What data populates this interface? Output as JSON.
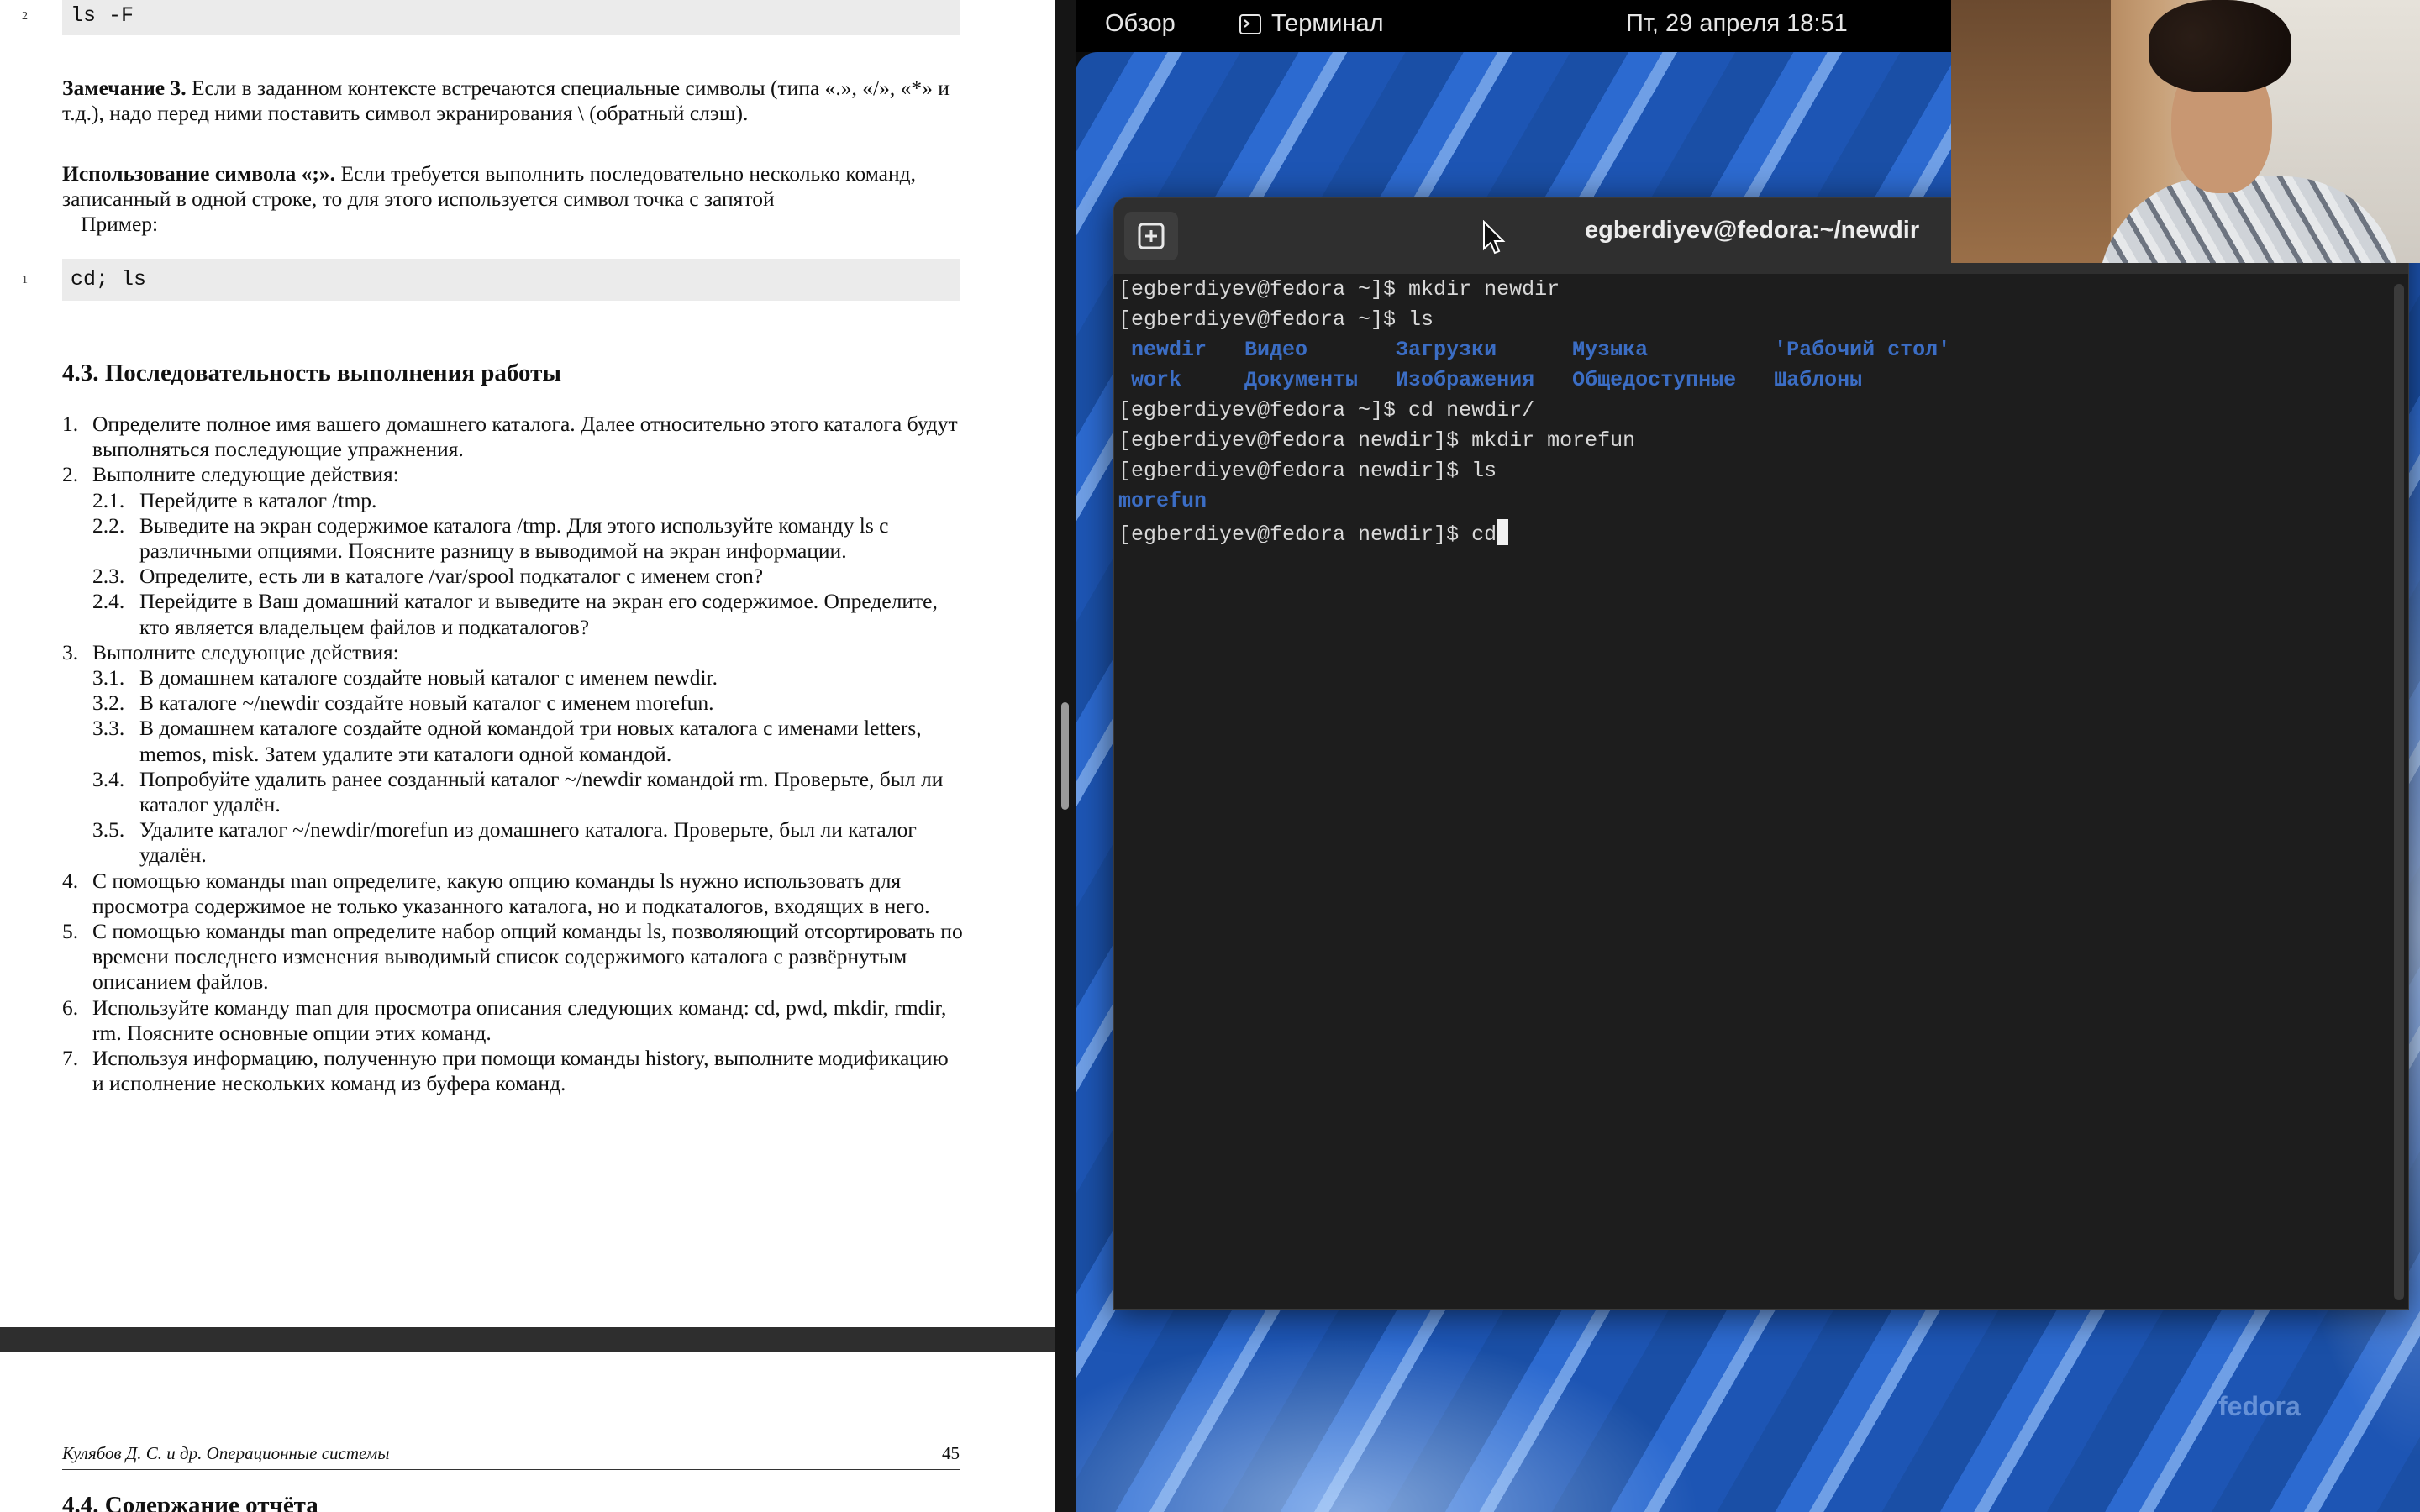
{
  "document": {
    "code_top": {
      "line_no": "2",
      "code": "ls -F"
    },
    "remark": {
      "label": "Замечание 3.",
      "text": "Если в заданном контексте встречаются специальные символы (типа «.», «/», «*» и т.д.), надо перед ними поставить символ экранирования \\ (обратный слэш)."
    },
    "semicolon": {
      "label": "Использование символа «;».",
      "text": "Если требуется выполнить последовательно несколько команд, записанный в одной строке, то для этого используется символ точка с запятой",
      "example": "Пример:"
    },
    "code_example": {
      "line_no": "1",
      "code": "cd; ls"
    },
    "section_title": "4.3.  Последовательность выполнения работы",
    "steps": [
      {
        "n": "1.",
        "text": "Определите полное имя вашего домашнего каталога. Далее относительно этого каталога будут выполняться последующие упражнения."
      },
      {
        "n": "2.",
        "text": "Выполните следующие действия:"
      },
      {
        "n": "2.1.",
        "text": "Перейдите в каталог /tmp.",
        "sub": true
      },
      {
        "n": "2.2.",
        "text": "Выведите на экран содержимое каталога /tmp. Для этого используйте команду ls с различными опциями. Поясните разницу в выводимой на экран информации.",
        "sub": true
      },
      {
        "n": "2.3.",
        "text": "Определите, есть ли в каталоге /var/spool подкаталог с именем cron?",
        "sub": true
      },
      {
        "n": "2.4.",
        "text": "Перейдите в Ваш домашний каталог и выведите на экран его содержимое. Определите, кто является владельцем файлов и подкаталогов?",
        "sub": true
      },
      {
        "n": "3.",
        "text": "Выполните следующие действия:"
      },
      {
        "n": "3.1.",
        "text": "В домашнем каталоге создайте новый каталог с именем newdir.",
        "sub": true
      },
      {
        "n": "3.2.",
        "text": "В каталоге ~/newdir создайте новый каталог с именем morefun.",
        "sub": true
      },
      {
        "n": "3.3.",
        "text": "В домашнем каталоге создайте одной командой три новых каталога с именами letters, memos, misk. Затем удалите эти каталоги одной командой.",
        "sub": true
      },
      {
        "n": "3.4.",
        "text": "Попробуйте удалить ранее созданный каталог ~/newdir командой rm. Проверьте, был ли каталог удалён.",
        "sub": true
      },
      {
        "n": "3.5.",
        "text": "Удалите каталог ~/newdir/morefun из домашнего каталога. Проверьте, был ли каталог удалён.",
        "sub": true
      },
      {
        "n": "4.",
        "text": "С помощью команды man определите, какую опцию команды ls нужно использовать для просмотра содержимое не только указанного каталога, но и подкаталогов, входящих в него."
      },
      {
        "n": "5.",
        "text": "С помощью команды man определите набор опций команды ls, позволяющий отсортировать по времени последнего изменения выводимый список содержимого каталога с развёрнутым описанием файлов."
      },
      {
        "n": "6.",
        "text": "Используйте команду man для просмотра описания следующих команд: cd, pwd, mkdir, rmdir, rm. Поясните основные опции этих команд."
      },
      {
        "n": "7.",
        "text": "Используя информацию, полученную при помощи команды history, выполните модификацию и исполнение нескольких команд из буфера команд."
      }
    ],
    "footer": {
      "left": "Кулябов Д. С. и др. Операционные системы",
      "page": "45"
    },
    "next_section": "4.4.  Содержание отчёта"
  },
  "topbar": {
    "overview": "Обзор",
    "app": "Терминал",
    "clock": "Пт, 29 апреля  18:51"
  },
  "terminal": {
    "title": "egberdiyev@fedora:~/newdir",
    "lines": [
      {
        "text": "[egberdiyev@fedora ~]$ mkdir newdir"
      },
      {
        "text": "[egberdiyev@fedora ~]$ ls"
      },
      {
        "text": " newdir   Видео       Загрузки      Музыка          'Рабочий стол'",
        "blue": true
      },
      {
        "text": " work     Документы   Изображения   Общедоступные   Шаблоны",
        "blue": true
      },
      {
        "text": "[egberdiyev@fedora ~]$ cd newdir/"
      },
      {
        "text": "[egberdiyev@fedora newdir]$ mkdir morefun"
      },
      {
        "text": "[egberdiyev@fedora newdir]$ ls"
      },
      {
        "text": "morefun",
        "blue": true
      },
      {
        "text": "[egberdiyev@fedora newdir]$ cd"
      }
    ]
  },
  "wallpaper_logo": "fedora",
  "colors": {
    "dir_blue": "#3b6dc4",
    "terminal_bg": "#1d1d1d",
    "topbar_bg": "#000000"
  }
}
